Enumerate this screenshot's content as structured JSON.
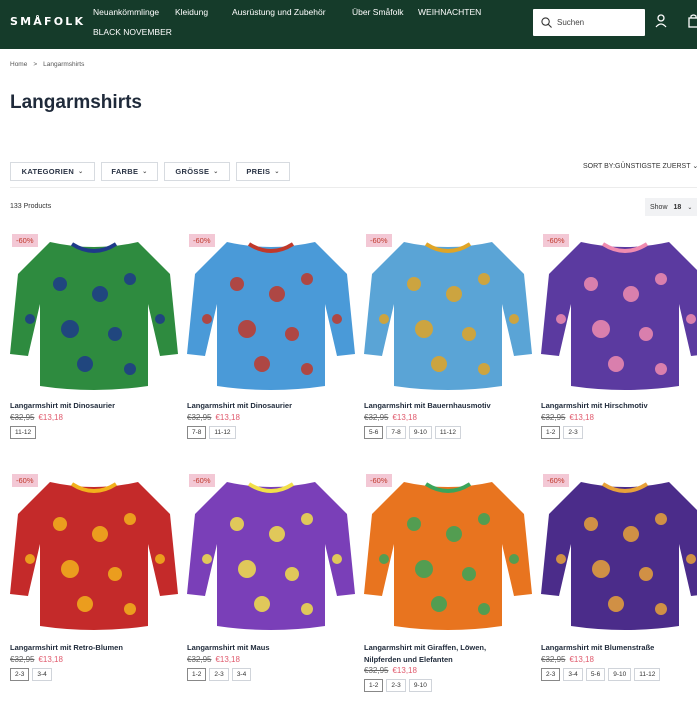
{
  "header": {
    "logo": "SMÅFOLK",
    "nav": [
      "Neuankömmlinge",
      "Kleidung",
      "Ausrüstung und Zubehör",
      "Über Småfolk",
      "WEIHNACHTEN",
      "BLACK NOVEMBER"
    ],
    "search_placeholder": "Suchen",
    "icons": [
      "search-icon",
      "user-icon",
      "cart-icon"
    ]
  },
  "breadcrumb": [
    "Home",
    ">",
    "Langarmshirts"
  ],
  "page_title": "Langarmshirts",
  "filters": [
    "KATEGORIEN",
    "FARBE",
    "GRÖSSE",
    "PREIS"
  ],
  "sort_by": "SORT BY:GÜNSTIGSTE ZUERST",
  "product_count": "133 Products",
  "show": {
    "label": "Show",
    "value": "18"
  },
  "products": [
    {
      "badge": "-60%",
      "name": "Langarmshirt mit Dinosaurier",
      "old_price": "€32,95",
      "new_price": "€13,18",
      "sizes": [
        "11-12"
      ],
      "color": "#2e8b3f",
      "pattern": "#1e3a8a"
    },
    {
      "badge": "-60%",
      "name": "Langarmshirt mit Dinosaurier",
      "old_price": "€32,95",
      "new_price": "€13,18",
      "sizes": [
        "7-8",
        "11-12"
      ],
      "color": "#4a9ad8",
      "pattern": "#c0392b"
    },
    {
      "badge": "-60%",
      "name": "Langarmshirt mit Bauernhausmotiv",
      "old_price": "€32,95",
      "new_price": "€13,18",
      "sizes": [
        "5-6",
        "7-8",
        "9-10",
        "11-12"
      ],
      "color": "#5aa4d6",
      "pattern": "#e0a526"
    },
    {
      "badge": "-60%",
      "name": "Langarmshirt mit Hirschmotiv",
      "old_price": "€32,95",
      "new_price": "€13,18",
      "sizes": [
        "1-2",
        "2-3"
      ],
      "color": "#5b3aa0",
      "pattern": "#f08cb0"
    },
    {
      "badge": "-60%",
      "name": "Langarmshirt mit Retro-Blumen",
      "old_price": "€32,95",
      "new_price": "€13,18",
      "sizes": [
        "2-3",
        "3-4"
      ],
      "color": "#c42a2a",
      "pattern": "#f2b21c"
    },
    {
      "badge": "-60%",
      "name": "Langarmshirt mit Maus",
      "old_price": "€32,95",
      "new_price": "€13,18",
      "sizes": [
        "1-2",
        "2-3",
        "3-4"
      ],
      "color": "#7a3fb8",
      "pattern": "#f2e04a"
    },
    {
      "badge": "-60%",
      "name": "Langarmshirt mit Giraffen, Löwen,",
      "name2": "Nilpferden und Elefanten",
      "old_price": "€32,95",
      "new_price": "€13,18",
      "sizes": [
        "1-2",
        "2-3",
        "9-10"
      ],
      "color": "#e8741f",
      "pattern": "#3aa55a"
    },
    {
      "badge": "-60%",
      "name": "Langarmshirt mit Blumenstraße",
      "old_price": "€32,95",
      "new_price": "€13,18",
      "sizes": [
        "2-3",
        "3-4",
        "5-6",
        "9-10",
        "11-12"
      ],
      "color": "#4b2c8a",
      "pattern": "#e8a23a"
    }
  ]
}
